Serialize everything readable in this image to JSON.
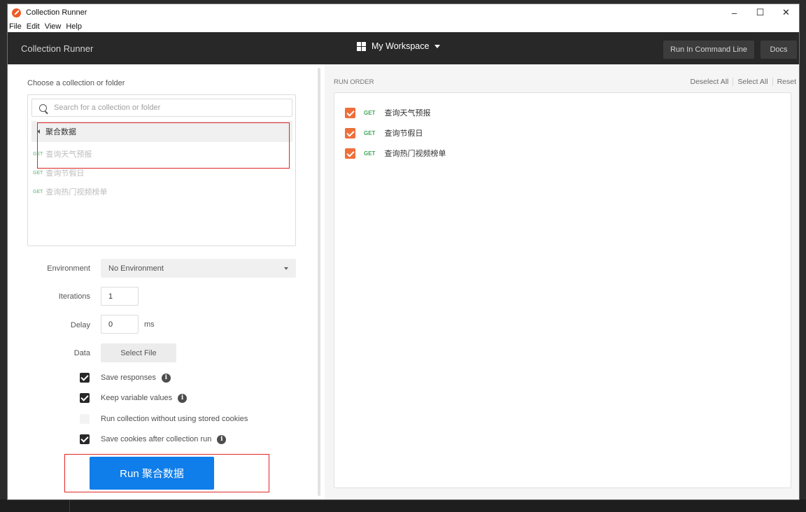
{
  "window": {
    "title": "Collection Runner",
    "controls": {
      "minimize": "–",
      "maximize": "☐",
      "close": "✕"
    }
  },
  "menu": [
    "File",
    "Edit",
    "View",
    "Help"
  ],
  "header": {
    "title": "Collection Runner",
    "workspace": "My Workspace",
    "run_cmd_label": "Run In Command Line",
    "docs_label": "Docs"
  },
  "collection": {
    "choose_label": "Choose a collection or folder",
    "search_placeholder": "Search for a collection or folder",
    "folder_name": "聚合数据",
    "requests": [
      {
        "method": "GET",
        "name": "查询天气预报"
      },
      {
        "method": "GET",
        "name": "查询节假日"
      },
      {
        "method": "GET",
        "name": "查询热门视频榜单"
      }
    ]
  },
  "form": {
    "environment_label": "Environment",
    "environment_value": "No Environment",
    "iterations_label": "Iterations",
    "iterations_value": "1",
    "delay_label": "Delay",
    "delay_value": "0",
    "delay_unit": "ms",
    "data_label": "Data",
    "select_file_label": "Select File"
  },
  "options": [
    {
      "label": "Save responses",
      "checked": true,
      "info": true
    },
    {
      "label": "Keep variable values",
      "checked": true,
      "info": true
    },
    {
      "label": "Run collection without using stored cookies",
      "checked": false,
      "info": false
    },
    {
      "label": "Save cookies after collection run",
      "checked": true,
      "info": true
    }
  ],
  "run_button_label": "Run 聚合数据",
  "run_order": {
    "title": "RUN ORDER",
    "deselect_all": "Deselect All",
    "select_all": "Select All",
    "reset": "Reset",
    "items": [
      {
        "method": "GET",
        "name": "查询天气预报",
        "checked": true
      },
      {
        "method": "GET",
        "name": "查询节假日",
        "checked": true
      },
      {
        "method": "GET",
        "name": "查询热门视频榜单",
        "checked": true
      }
    ]
  },
  "colors": {
    "accent_orange": "#ef6e3a",
    "run_blue": "#0f7dea",
    "header_dark": "#282828",
    "highlight_red": "#e02424"
  }
}
